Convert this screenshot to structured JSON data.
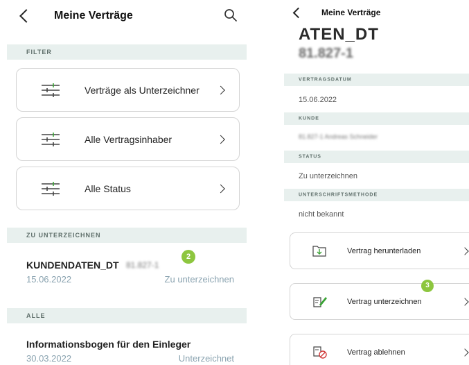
{
  "left": {
    "title": "Meine Verträge",
    "filter_section": "FILTER",
    "filters": [
      {
        "label": "Verträge als Unterzeichner",
        "icon": "sliders-icon"
      },
      {
        "label": "Alle Vertragsinhaber",
        "icon": "sliders-icon"
      },
      {
        "label": "Alle Status",
        "icon": "sliders-icon"
      }
    ],
    "to_sign_section": "ZU UNTERZEICHNEN",
    "to_sign_item": {
      "title": "KUNDENDATEN_DT",
      "id": "81.827-1",
      "date": "15.06.2022",
      "status": "Zu unterzeichnen"
    },
    "badge": "2",
    "all_section": "ALLE",
    "all_item": {
      "title": "Informationsbogen für den Einleger",
      "date": "30.03.2022",
      "status": "Unterzeichnet"
    }
  },
  "right": {
    "title": "Meine Verträge",
    "contract_title": "ATEN_DT",
    "contract_id": "81.827-1",
    "fields": [
      {
        "label": "VERTRAGSDATUM",
        "value": "15.06.2022"
      },
      {
        "label": "KUNDE",
        "value": "81.827-1 Andreas Schneider"
      },
      {
        "label": "STATUS",
        "value": "Zu unterzeichnen"
      },
      {
        "label": "UNTERSCHRIFTSMETHODE",
        "value": "nicht bekannt"
      }
    ],
    "actions": [
      {
        "label": "Vertrag herunterladen",
        "icon": "folder-download-icon"
      },
      {
        "label": "Vertrag unterzeichnen",
        "icon": "sign-document-icon"
      },
      {
        "label": "Vertrag ablehnen",
        "icon": "reject-document-icon"
      }
    ],
    "badge": "3"
  },
  "colors": {
    "accent_green": "#8dc63f",
    "section_bg": "#e8f0ee",
    "muted_text": "#8aa3b0",
    "icon_green": "#3aa335"
  }
}
